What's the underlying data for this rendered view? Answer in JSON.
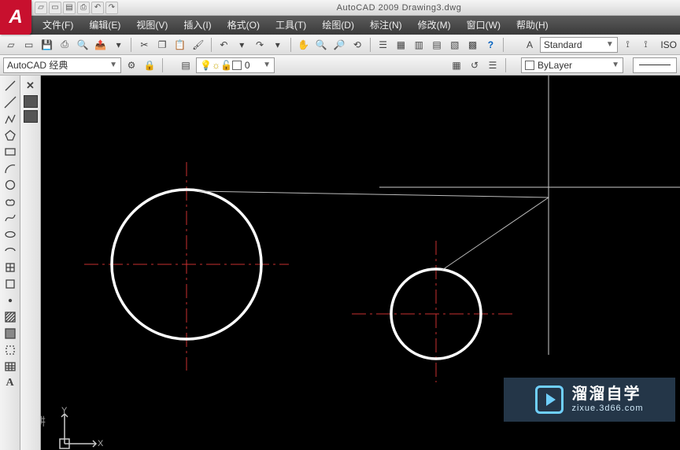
{
  "title": "AutoCAD 2009 Drawing3.dwg",
  "menus": [
    "文件(F)",
    "编辑(E)",
    "视图(V)",
    "插入(I)",
    "格式(O)",
    "工具(T)",
    "绘图(D)",
    "标注(N)",
    "修改(M)",
    "窗口(W)",
    "帮助(H)"
  ],
  "workspace": "AutoCAD 经典",
  "text_style": "Standard",
  "dim_style_prefix": "ISO",
  "layer_current": "0",
  "layer_style": "ByLayer",
  "watermark": {
    "line1": "溜溜自学",
    "line2": "zixue.3d66.com"
  },
  "ucs": {
    "x": "X",
    "y": "Y"
  }
}
